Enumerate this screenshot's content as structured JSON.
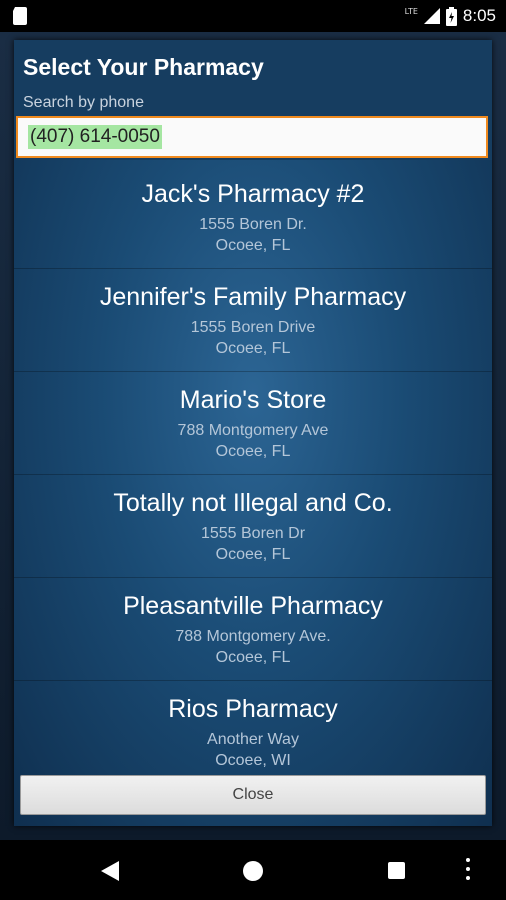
{
  "status_bar": {
    "time": "8:05",
    "network": "LTE",
    "icons": [
      "sd-card-icon",
      "signal-icon",
      "battery-icon"
    ]
  },
  "dialog": {
    "title": "Select Your Pharmacy",
    "search_label": "Search by phone",
    "search_value": "(407) 614-0050",
    "close_label": "Close"
  },
  "pharmacies": [
    {
      "name": "Jack's Pharmacy #2",
      "address": "1555 Boren Dr.",
      "city": "Ocoee, FL"
    },
    {
      "name": "Jennifer's Family Pharmacy",
      "address": "1555 Boren Drive",
      "city": "Ocoee, FL"
    },
    {
      "name": "Mario's Store",
      "address": "788 Montgomery Ave",
      "city": "Ocoee, FL"
    },
    {
      "name": "Totally not Illegal and Co.",
      "address": "1555 Boren Dr",
      "city": "Ocoee, FL"
    },
    {
      "name": "Pleasantville Pharmacy",
      "address": "788 Montgomery Ave.",
      "city": "Ocoee, FL"
    },
    {
      "name": "Rios Pharmacy",
      "address": "Another Way",
      "city": "Ocoee, WI"
    }
  ],
  "nav_bar": {
    "icons": [
      "back-icon",
      "home-icon",
      "recents-icon",
      "overflow-menu-icon"
    ]
  },
  "colors": {
    "dialog_bg": "#1a4b74",
    "input_border": "#f08a1e",
    "selection_highlight": "#a5e6a2"
  }
}
